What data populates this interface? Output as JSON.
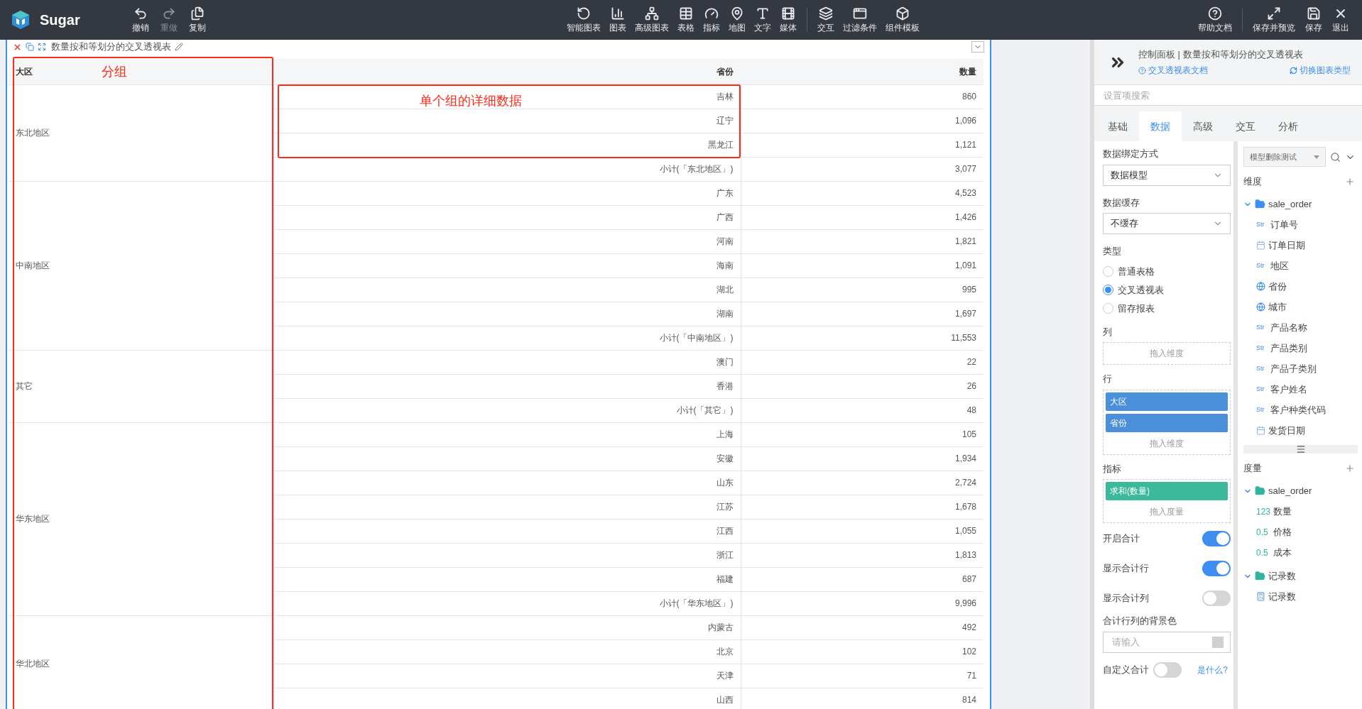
{
  "app": {
    "name": "Sugar"
  },
  "toolbar_left": [
    {
      "label": "撤销",
      "disabled": false
    },
    {
      "label": "重做",
      "disabled": true
    },
    {
      "label": "复制",
      "disabled": false
    }
  ],
  "toolbar_center": [
    {
      "label": "智能图表"
    },
    {
      "label": "图表"
    },
    {
      "label": "高级图表"
    },
    {
      "label": "表格"
    },
    {
      "label": "指标"
    },
    {
      "label": "地图"
    },
    {
      "label": "文字"
    },
    {
      "label": "媒体"
    }
  ],
  "toolbar_center_2": [
    {
      "label": "交互"
    },
    {
      "label": "过滤条件"
    },
    {
      "label": "组件模板"
    }
  ],
  "toolbar_right": [
    {
      "label": "帮助文档"
    }
  ],
  "toolbar_right_2": [
    {
      "label": "保存并预览"
    },
    {
      "label": "保存"
    },
    {
      "label": "退出"
    }
  ],
  "component": {
    "title": "数量按和等划分的交叉透视表",
    "columns": [
      "大区",
      "省份",
      "数量"
    ],
    "groups": [
      {
        "name": "东北地区",
        "rows": [
          [
            "吉林",
            "860"
          ],
          [
            "辽宁",
            "1,096"
          ],
          [
            "黑龙江",
            "1,121"
          ],
          [
            "小计(「东北地区」)",
            "3,077"
          ]
        ]
      },
      {
        "name": "中南地区",
        "rows": [
          [
            "广东",
            "4,523"
          ],
          [
            "广西",
            "1,426"
          ],
          [
            "河南",
            "1,821"
          ],
          [
            "海南",
            "1,091"
          ],
          [
            "湖北",
            "995"
          ],
          [
            "湖南",
            "1,697"
          ],
          [
            "小计(「中南地区」)",
            "11,553"
          ]
        ]
      },
      {
        "name": "其它",
        "rows": [
          [
            "澳门",
            "22"
          ],
          [
            "香港",
            "26"
          ],
          [
            "小计(「其它」)",
            "48"
          ]
        ]
      },
      {
        "name": "华东地区",
        "rows": [
          [
            "上海",
            "105"
          ],
          [
            "安徽",
            "1,934"
          ],
          [
            "山东",
            "2,724"
          ],
          [
            "江苏",
            "1,678"
          ],
          [
            "江西",
            "1,055"
          ],
          [
            "浙江",
            "1,813"
          ],
          [
            "福建",
            "687"
          ],
          [
            "小计(「华东地区」)",
            "9,996"
          ]
        ]
      },
      {
        "name": "华北地区",
        "rows": [
          [
            "内蒙古",
            "492"
          ],
          [
            "北京",
            "102"
          ],
          [
            "天津",
            "71"
          ],
          [
            "山西",
            "814"
          ]
        ]
      }
    ],
    "annotations": [
      {
        "text": "分组"
      },
      {
        "text": "单个组的详细数据"
      }
    ]
  },
  "panel": {
    "title": "控制面板 | 数量按和等划分的交叉透视表",
    "doc_link": "交叉透视表文档",
    "switch_link": "切换图表类型",
    "search_placeholder": "设置项搜索",
    "tabs": [
      {
        "label": "基础",
        "selected": false
      },
      {
        "label": "数据",
        "selected": true
      },
      {
        "label": "高级",
        "selected": false
      },
      {
        "label": "交互",
        "selected": false
      },
      {
        "label": "分析",
        "selected": false
      }
    ]
  },
  "settings": {
    "binding": {
      "label": "数据绑定方式",
      "value": "数据模型"
    },
    "cache": {
      "label": "数据缓存",
      "value": "不缓存"
    },
    "type": {
      "label": "类型",
      "options": [
        {
          "label": "普通表格",
          "selected": false
        },
        {
          "label": "交叉透视表",
          "selected": true
        },
        {
          "label": "留存报表",
          "selected": false
        }
      ]
    },
    "drops": [
      {
        "label": "列",
        "hint": "拖入维度"
      },
      {
        "label": "行",
        "fields": [
          "大区",
          "省份"
        ],
        "hint": "拖入维度",
        "kind": "dimension"
      },
      {
        "label": "指标",
        "fields": [
          "求和(数量)"
        ],
        "hint": "拖入度量",
        "kind": "measure"
      }
    ],
    "toggles": [
      {
        "label": "开启合计",
        "on": true
      },
      {
        "label": "显示合计行",
        "on": true
      },
      {
        "label": "显示合计列",
        "on": false
      }
    ],
    "bg_color": {
      "label": "合计行列的背景色",
      "placeholder": "请输入"
    },
    "custom_total": {
      "label": "自定义合计",
      "on": false,
      "help": "是什么?"
    }
  },
  "fields": {
    "model": "模型删除测试",
    "sections": [
      {
        "label": "维度",
        "folders": [
          {
            "name": "sale_order",
            "expanded": true,
            "children": [
              {
                "name": "订单号",
                "kind": "text",
                "badge": "Str"
              },
              {
                "name": "订单日期",
                "kind": "date"
              },
              {
                "name": "地区",
                "kind": "text",
                "badge": "Str"
              },
              {
                "name": "省份",
                "kind": "geo"
              },
              {
                "name": "城市",
                "kind": "geo"
              },
              {
                "name": "产品名称",
                "kind": "text",
                "badge": "Str"
              },
              {
                "name": "产品类别",
                "kind": "text",
                "badge": "Str"
              },
              {
                "name": "产品子类别",
                "kind": "text",
                "badge": "Str"
              },
              {
                "name": "客户姓名",
                "kind": "text",
                "badge": "Str"
              },
              {
                "name": "客户种类代码",
                "kind": "text",
                "badge": "Str"
              },
              {
                "name": "发货日期",
                "kind": "date"
              }
            ]
          }
        ]
      },
      {
        "label": "度量",
        "folders": [
          {
            "name": "sale_order",
            "expanded": true,
            "children": [
              {
                "name": "数量",
                "kind": "number",
                "badge": "123"
              },
              {
                "name": "价格",
                "kind": "number",
                "badge": "0.5"
              },
              {
                "name": "成本",
                "kind": "number",
                "badge": "0.5"
              }
            ]
          },
          {
            "name": "记录数",
            "expanded": true,
            "children": [
              {
                "name": "记录数",
                "kind": "count"
              }
            ]
          }
        ]
      }
    ]
  }
}
